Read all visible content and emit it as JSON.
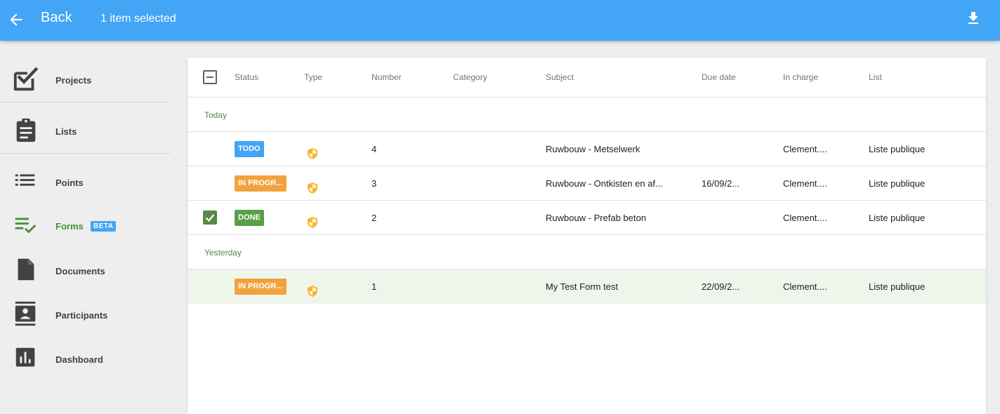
{
  "topbar": {
    "back_label": "Back",
    "selection_text": "1 item selected",
    "color": "#42a5f5"
  },
  "sidebar": {
    "items": [
      {
        "label": "Projects",
        "icon": "projects-check-icon"
      },
      {
        "label": "Lists",
        "icon": "clipboard-icon"
      },
      {
        "label": "Points",
        "icon": "list-icon"
      },
      {
        "label": "Forms",
        "icon": "checklist-icon",
        "active": true,
        "badge": "BETA"
      },
      {
        "label": "Documents",
        "icon": "document-icon"
      },
      {
        "label": "Participants",
        "icon": "contact-card-icon"
      },
      {
        "label": "Dashboard",
        "icon": "bar-chart-icon"
      }
    ],
    "active_color": "#4c8c3c"
  },
  "table": {
    "columns": [
      "Status",
      "Type",
      "Number",
      "Category",
      "Subject",
      "Due date",
      "In charge",
      "List"
    ],
    "groups": [
      {
        "label": "Today",
        "rows": [
          {
            "status": "TODO",
            "status_color": "#42a5f5",
            "number": "4",
            "category": "",
            "subject": "Ruwbouw - Metselwerk",
            "due": "",
            "in_charge": "Clement....",
            "list": "Liste publique",
            "checked": false
          },
          {
            "status": "IN PROGR...",
            "status_color": "#f0a33d",
            "number": "3",
            "category": "",
            "subject": "Ruwbouw - Ontkisten en af...",
            "due": "16/09/2...",
            "in_charge": "Clement....",
            "list": "Liste publique",
            "checked": false
          },
          {
            "status": "DONE",
            "status_color": "#5a9e48",
            "number": "2",
            "category": "",
            "subject": "Ruwbouw - Prefab beton",
            "due": "",
            "in_charge": "Clement....",
            "list": "Liste publique",
            "checked": true
          }
        ]
      },
      {
        "label": "Yesterday",
        "rows": [
          {
            "status": "IN PROGR...",
            "status_color": "#f0a33d",
            "number": "1",
            "category": "",
            "subject": "My Test Form test",
            "due": "22/09/2...",
            "in_charge": "Clement....",
            "list": "Liste publique",
            "checked": false
          }
        ]
      }
    ],
    "shield_color": "#f5b82e"
  }
}
